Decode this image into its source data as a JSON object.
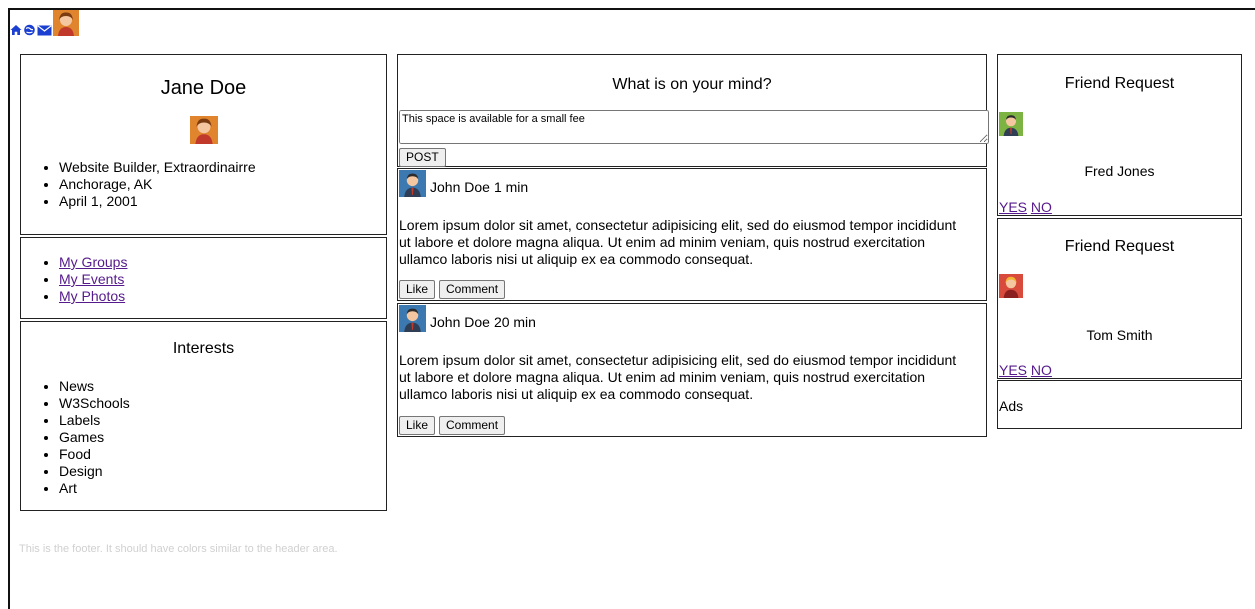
{
  "nav": {
    "home_icon": "home-icon",
    "globe_icon": "globe-icon",
    "mail_icon": "mail-icon",
    "avatar_icon": "avatar-icon"
  },
  "profile": {
    "name": "Jane Doe",
    "details": [
      "Website Builder, Extraordinairre",
      "Anchorage, AK",
      "April 1, 2001"
    ]
  },
  "links": [
    "My Groups",
    "My Events",
    "My Photos"
  ],
  "interests": {
    "title": "Interests",
    "items": [
      "News",
      "W3Schools",
      "Labels",
      "Games",
      "Food",
      "Design",
      "Art"
    ]
  },
  "compose": {
    "title": "What is on your mind?",
    "textarea_value": "This space is available for a small fee",
    "post_label": "POST"
  },
  "posts": [
    {
      "author": "John Doe",
      "time": "1 min",
      "body": "Lorem ipsum dolor sit amet, consectetur adipisicing elit, sed do eiusmod tempor incididunt ut labore et dolore magna aliqua. Ut enim ad minim veniam, quis nostrud exercitation ullamco laboris nisi ut aliquip ex ea commodo consequat.",
      "like_label": "Like",
      "comment_label": "Comment"
    },
    {
      "author": "John Doe",
      "time": "20 min",
      "body": "Lorem ipsum dolor sit amet, consectetur adipisicing elit, sed do eiusmod tempor incididunt ut labore et dolore magna aliqua. Ut enim ad minim veniam, quis nostrud exercitation ullamco laboris nisi ut aliquip ex ea commodo consequat.",
      "like_label": "Like",
      "comment_label": "Comment"
    }
  ],
  "friend_requests": [
    {
      "title": "Friend Request",
      "name": "Fred Jones",
      "yes": "YES",
      "no": "NO"
    },
    {
      "title": "Friend Request",
      "name": "Tom Smith",
      "yes": "YES",
      "no": "NO"
    }
  ],
  "ads": {
    "label": "Ads"
  },
  "footer": {
    "text": "This is the footer. It should have colors similar to the header area."
  },
  "colors": {
    "link": "#551a8b",
    "nav_icon": "#1a3fd1",
    "footer_text": "#d0d0d0"
  }
}
